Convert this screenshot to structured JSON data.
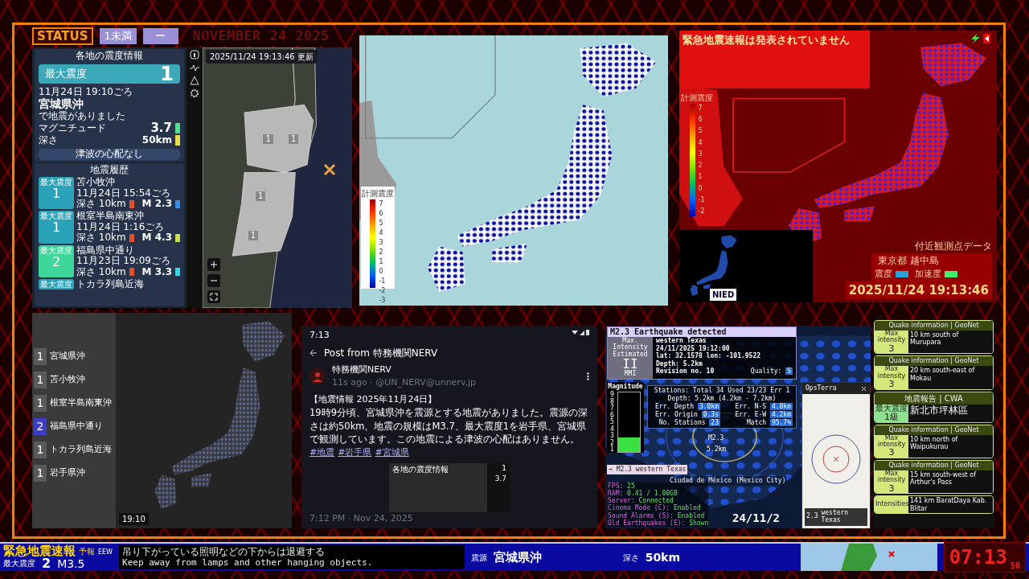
{
  "status_bar": {
    "label": "STATUS",
    "intensity": "1未満",
    "value": "ー",
    "date": "NOVEMBER 24 2025"
  },
  "quake_app": {
    "panel_title": "各地の震度情報",
    "max_intensity_label": "最大震度",
    "max_intensity": "1",
    "time": "11月24日 19:10ごろ",
    "epicenter": "宮城県沖",
    "note": "で地震がありました",
    "readings": [
      {
        "label": "マグニチュード",
        "value": "3.7",
        "color": "#52e08a"
      },
      {
        "label": "深さ",
        "value": "50km",
        "color": "#e8e04a"
      }
    ],
    "tsunami": "津波の心配なし",
    "history_title": "地震履歴",
    "history": [
      {
        "badge": "最大震度",
        "intensity": "1",
        "place": "苫小牧沖",
        "time": "11月24日 15:54ごろ",
        "depth_label": "深さ",
        "depth": "10km",
        "magnitude": "M 2.3",
        "color": "#2aa3b8",
        "depth_bar": {
          "color": "#e0502a"
        },
        "magnitude_bar": {
          "color": "#3a8ee6"
        }
      },
      {
        "badge": "最大震度",
        "intensity": "1",
        "place": "根室半島南東沖",
        "time": "11月24日 1:16ごろ",
        "depth_label": "深さ",
        "depth": "10km",
        "magnitude": "M 4.3",
        "color": "#2aa3b8",
        "depth_bar": {
          "color": "#e0502a"
        },
        "magnitude_bar": {
          "color": "#c8e04a"
        }
      },
      {
        "badge": "最大震度",
        "intensity": "2",
        "place": "福島県中通り",
        "time": "11月23日 19:09ごろ",
        "depth_label": "深さ",
        "depth": "10km",
        "magnitude": "M 3.3",
        "color": "#3ed69a",
        "depth_bar": {
          "color": "#e0502a"
        },
        "magnitude_bar": {
          "color": "#3ad6e0"
        }
      },
      {
        "badge": "最大震度",
        "place": "トカラ列島近海",
        "color": "#2aa3b8"
      }
    ],
    "map": {
      "updated": "2025/11/24 19:13:46",
      "updated_label": "更新",
      "markers": [
        "1",
        "1",
        "1",
        "1"
      ]
    }
  },
  "station_map": {
    "legend_title": "計測震度",
    "ticks": [
      "7",
      "6",
      "5",
      "4",
      "3",
      "2",
      "1",
      "0",
      "-1",
      "-2",
      "-3"
    ]
  },
  "alert_map": {
    "alert": "緊急地震速報は発表されていません",
    "scale_title": "計測震度",
    "ticks": [
      "7",
      "6",
      "5",
      "4",
      "3",
      "2",
      "1",
      "0",
      "-1",
      "-2"
    ],
    "station_heading": "付近観測点データ",
    "station": "東京都 越中島",
    "legend": [
      {
        "label": "震度",
        "color": "#2aa0d8"
      },
      {
        "label": "加速度",
        "color": "#3ef06a"
      }
    ],
    "timestamp": "2025/11/24 19:13:46",
    "logo": "NIED"
  },
  "list_map": {
    "time_label": "19:10",
    "items": [
      {
        "intensity": "1",
        "place": "宮城県沖",
        "color": "#5a5a5a"
      },
      {
        "intensity": "1",
        "place": "苫小牧沖",
        "color": "#5a5a5a"
      },
      {
        "intensity": "1",
        "place": "根室半島南東沖",
        "color": "#5a5a5a"
      },
      {
        "intensity": "2",
        "place": "福島県中通り",
        "color": "#3c3cc8"
      },
      {
        "intensity": "1",
        "place": "トカラ列島近海",
        "color": "#5a5a5a"
      },
      {
        "intensity": "1",
        "place": "岩手県沖",
        "color": "#5a5a5a"
      }
    ]
  },
  "post": {
    "clock": "7:13",
    "header": "Post from 特務機関NERV",
    "author": "特務機関NERV",
    "meta": "11s ago · @UN_NERV@unnerv.jp",
    "title": "【地震情報 2025年11月24日】",
    "body": "19時9分頃、宮城県沖を震源とする地震がありました。震源の深さは約50km、地震の規模はM3.7、最大震度1を岩手県、宮城県で観測しています。この地震による津波の心配はありません。",
    "tags": [
      "#地震",
      "#岩手県",
      "#宮城県"
    ],
    "image": {
      "title": "各地の震度情報",
      "values": [
        "1",
        "3.7"
      ]
    },
    "footer": "7:12 PM · Nov 24, 2025"
  },
  "detector": {
    "title": "M2.3 Earthquake detected",
    "intensity_caption": "Max. Intensity Estimated",
    "intensity": "II",
    "intensity_unit": "MMI",
    "details": [
      "western Texas",
      "24/11/2025 19:12:00",
      "lat: 32.1578 lon: -101.9522",
      "Depth: 5.2km",
      "Revision no. 10"
    ],
    "quality_label": "Quality:",
    "quality": "S",
    "stations_lines": [
      "Stations: Total 34 Used 23/23 Err 1",
      "Depth: 5.2km (4.2km - 7.2km)"
    ],
    "errors": [
      {
        "label": "Err. Depth",
        "value": "3.0km"
      },
      {
        "label": "Err. N-S",
        "value": "4.8km"
      },
      {
        "label": "Err. Origin",
        "value": "0.3s"
      },
      {
        "label": "Err. E-W",
        "value": "4.2km"
      },
      {
        "label": "No. Stations",
        "value": "23"
      },
      {
        "label": "Match",
        "value": "95.7%"
      }
    ],
    "meter": {
      "title": "Magnitude",
      "ticks": [
        "9",
        "8",
        "7",
        "6",
        "5",
        "4",
        "3",
        "2",
        "1"
      ],
      "level": 0.25
    },
    "quake_label": "M2.3",
    "quake_depth": "5.2km",
    "event_tag": "→ M2.3 western Texas",
    "city": "Ciudad de México (Mexico City)",
    "date_partial": "24/11/2",
    "stats": [
      {
        "label": "FPS:",
        "value": "25"
      },
      {
        "label": "RAM:",
        "value": "0.41 / 1.00GB"
      },
      {
        "label": "Server:",
        "value": "Connected"
      },
      {
        "label": "Cinema Mode (C):",
        "value": "Enabled"
      },
      {
        "label": "Sound Alarms (S):",
        "value": "Enabled"
      },
      {
        "label": "Old Earthquakes (E):",
        "value": "Shown"
      }
    ],
    "window": {
      "title": "OpsTerra",
      "card_value": "2.3",
      "card_place": "western Texas"
    }
  },
  "quake_feed": [
    {
      "header": "Quake information | GeoNet",
      "label": "Max intensity",
      "intensity": "3",
      "place": "10 km south of Murupara",
      "color": "#d4e87a"
    },
    {
      "header": "Quake information | GeoNet",
      "label": "Max intensity",
      "intensity": "3",
      "place": "20 km south-east of Mokau",
      "color": "#d4e87a"
    },
    {
      "header": "地震報告 | CWA",
      "label": "最大震度",
      "intensity": "1級",
      "place": "新北市坪林區",
      "color": "#8fe08f"
    },
    {
      "header": "Quake information | GeoNet",
      "label": "Max intensity",
      "intensity": "3",
      "place": "10 km north of Waipukurau",
      "color": "#d4e87a"
    },
    {
      "header": "Quake information | GeoNet",
      "label": "Max intensity",
      "intensity": "3",
      "place": "15 km south-west of Arthur's Pass",
      "color": "#d4e87a"
    },
    {
      "label": "Intensities",
      "place": "141 km BaratDaya Kab. Blitar",
      "color": "#d4e87a"
    }
  ],
  "ticker": {
    "title": "緊急地震速報",
    "subtitle": "予報",
    "tag": "EEW",
    "lines": [
      "吊り下がっている照明などの下からは退避する",
      "Keep away from lamps and other hanging objects."
    ],
    "max_label": "最大震度",
    "max_intensity": "2",
    "magnitude": "M3.5",
    "source_label": "震源",
    "epicenter": "宮城県沖",
    "depth_label": "深さ",
    "depth": "50km",
    "clock": "07:13",
    "seconds": "50"
  }
}
